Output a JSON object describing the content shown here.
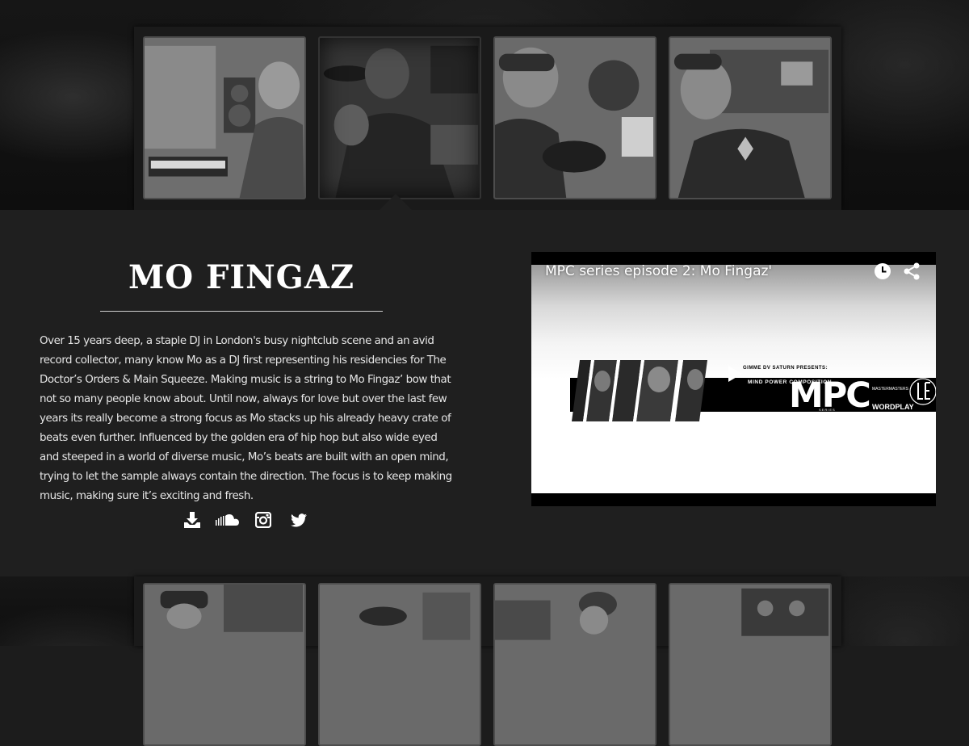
{
  "gallery_top": {
    "thumbnails": [
      {
        "alt": "thumbnail-1",
        "active": false
      },
      {
        "alt": "thumbnail-2",
        "active": true
      },
      {
        "alt": "thumbnail-3",
        "active": false
      },
      {
        "alt": "thumbnail-4",
        "active": false
      }
    ]
  },
  "gallery_bottom": {
    "thumbnails": [
      {
        "alt": "thumbnail-5"
      },
      {
        "alt": "thumbnail-6"
      },
      {
        "alt": "thumbnail-7"
      },
      {
        "alt": "thumbnail-8"
      }
    ]
  },
  "artist": {
    "name": "MO FINGAZ",
    "bio": "Over 15 years deep, a staple DJ in London's busy nightclub scene and an avid record collector, many know Mo as a DJ first representing his residencies for The Doctor’s Orders & Main Squeeze. Making music is a string to Mo Fingaz’ bow that not so many people know about. Until now, always for love but over the last few years its really become a strong focus as Mo stacks up his already heavy crate of beats even further. Influenced by the golden era of hip hop but also wide eyed and steeped in a world of diverse music, Mo’s beats are built with an open mind, trying to let the sample always contain the direction. The focus is to keep making music, making sure it’s exciting and fresh."
  },
  "social_links": [
    {
      "icon": "download-icon"
    },
    {
      "icon": "soundcloud-icon"
    },
    {
      "icon": "instagram-icon"
    },
    {
      "icon": "twitter-icon"
    }
  ],
  "video": {
    "title": "MPC series episode 2: Mo Fingaz'",
    "thumbnail": {
      "presents": "GIMME DV SATURN PRESENTS:",
      "subtitle": "MIND POWER COMPOSITION",
      "logo": "MPC",
      "series": "SERIES",
      "partner_1": "MASTERMASTERS",
      "partner_2": "WORDPLAY"
    }
  },
  "colors": {
    "panel_bg": "#1f1f1f",
    "text": "#e6e6e6",
    "title": "#ffffff"
  }
}
